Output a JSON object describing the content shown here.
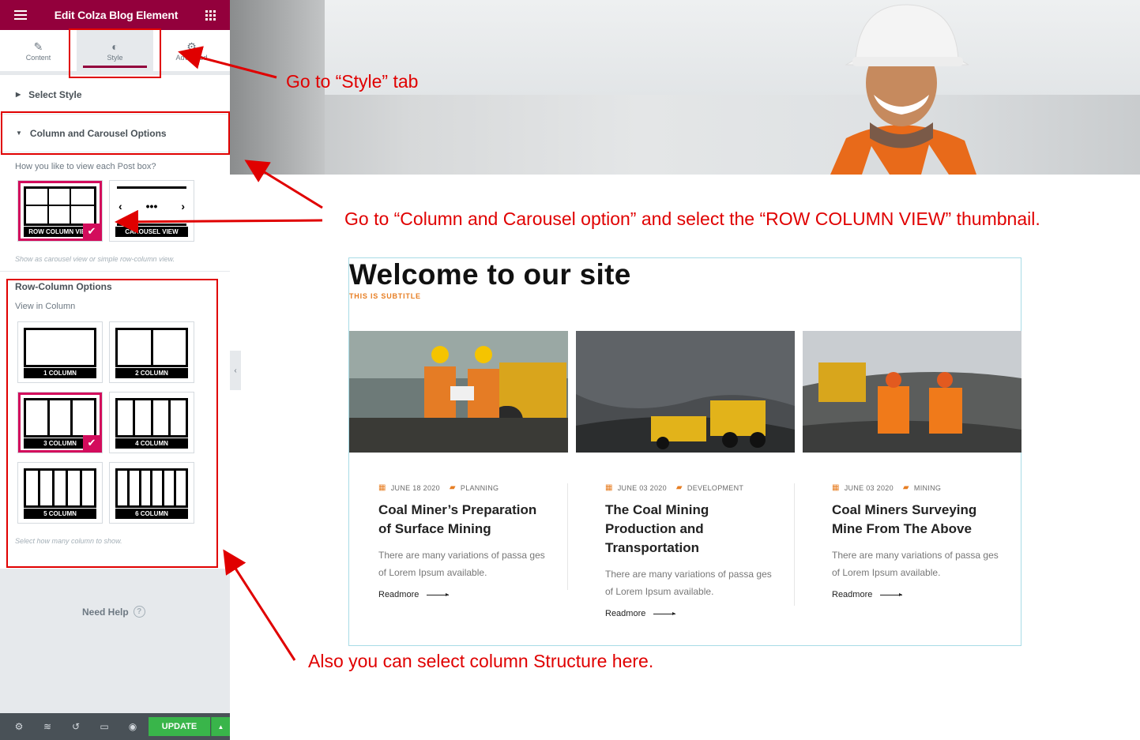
{
  "editor": {
    "title": "Edit Colza Blog Element",
    "tabs": [
      {
        "label": "Content",
        "icon": "pencil-icon"
      },
      {
        "label": "Style",
        "icon": "contrast-icon"
      },
      {
        "label": "Advanced",
        "icon": "gear-icon"
      }
    ],
    "sections": {
      "select_style": "Select Style",
      "column_carousel": "Column and Carousel Options"
    },
    "view_question": "How you like to view each Post box?",
    "view_thumbs": [
      "ROW COLUMN VIEW",
      "CAROUSEL VIEW"
    ],
    "view_note": "Show as carousel view or simple row-column view.",
    "row_column_title": "Row-Column Options",
    "view_in_column": "View in Column",
    "columns": [
      "1 COLUMN",
      "2 COLUMN",
      "3 COLUMN",
      "4 COLUMN",
      "5 COLUMN",
      "6 COLUMN"
    ],
    "selected_column": "3 COLUMN",
    "column_note": "Select how many column to show.",
    "need_help": "Need Help",
    "update": "UPDATE"
  },
  "site": {
    "title": "Welcome to our site",
    "subtitle": "THIS IS SUBTITLE",
    "posts": [
      {
        "date": "JUNE 18 2020",
        "category": "PLANNING",
        "title": "Coal Miner’s Preparation of Surface Mining",
        "excerpt": "There are many variations of passa ges of Lorem Ipsum available.",
        "readmore": "Readmore"
      },
      {
        "date": "JUNE 03 2020",
        "category": "DEVELOPMENT",
        "title": "The Coal Mining Production and Transportation",
        "excerpt": "There are many variations of passa ges of Lorem Ipsum available.",
        "readmore": "Readmore"
      },
      {
        "date": "JUNE 03 2020",
        "category": "MINING",
        "title": "Coal Miners Surveying Mine From The Above",
        "excerpt": "There are many variations of passa ges of Lorem Ipsum available.",
        "readmore": "Readmore"
      }
    ]
  },
  "annotations": {
    "style_tab": "Go  to “Style” tab",
    "column_option": "Go to “Column and Carousel option” and select the “ROW COLUMN VIEW” thumbnail.",
    "column_structure": "Also you can select column Structure here."
  },
  "colors": {
    "brand": "#93003c",
    "selected": "#d30c5c",
    "accent": "#e77e23",
    "annotation": "#e00000",
    "update": "#39b54a"
  }
}
